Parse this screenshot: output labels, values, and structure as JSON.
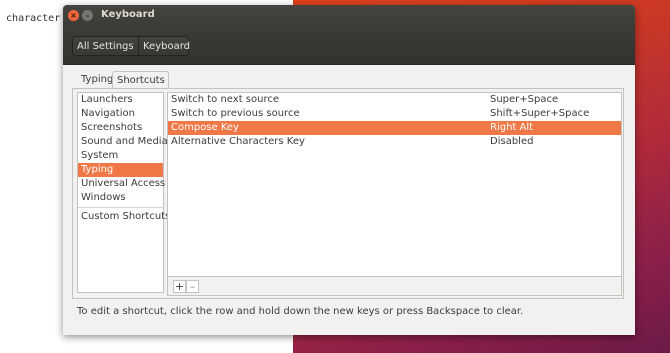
{
  "background": {
    "terminal_text": "l character"
  },
  "window": {
    "title": "Keyboard",
    "close_symbol": "×",
    "minimize_symbol": "–"
  },
  "toolbar": {
    "breadcrumbs": [
      "All Settings",
      "Keyboard"
    ]
  },
  "tabs": [
    {
      "label": "Typing",
      "active": false
    },
    {
      "label": "Shortcuts",
      "active": true
    }
  ],
  "categories": [
    {
      "label": "Launchers",
      "selected": false
    },
    {
      "label": "Navigation",
      "selected": false
    },
    {
      "label": "Screenshots",
      "selected": false
    },
    {
      "label": "Sound and Media",
      "selected": false
    },
    {
      "label": "System",
      "selected": false
    },
    {
      "label": "Typing",
      "selected": true
    },
    {
      "label": "Universal Access",
      "selected": false
    },
    {
      "label": "Windows",
      "selected": false
    },
    {
      "label": "Custom Shortcuts",
      "selected": false
    }
  ],
  "shortcuts": [
    {
      "name": "Switch to next source",
      "accel": "Super+Space",
      "selected": false
    },
    {
      "name": "Switch to previous source",
      "accel": "Shift+Super+Space",
      "selected": false
    },
    {
      "name": "Compose Key",
      "accel": "Right Alt",
      "selected": true
    },
    {
      "name": "Alternative Characters Key",
      "accel": "Disabled",
      "selected": false
    }
  ],
  "tools": {
    "add_label": "+",
    "remove_label": "–"
  },
  "hint": "To edit a shortcut, click the row and hold down the new keys or press Backspace to clear.",
  "colors": {
    "selection": "#f07746",
    "titlebar": "#3c3b37",
    "close_button": "#f0673e"
  }
}
